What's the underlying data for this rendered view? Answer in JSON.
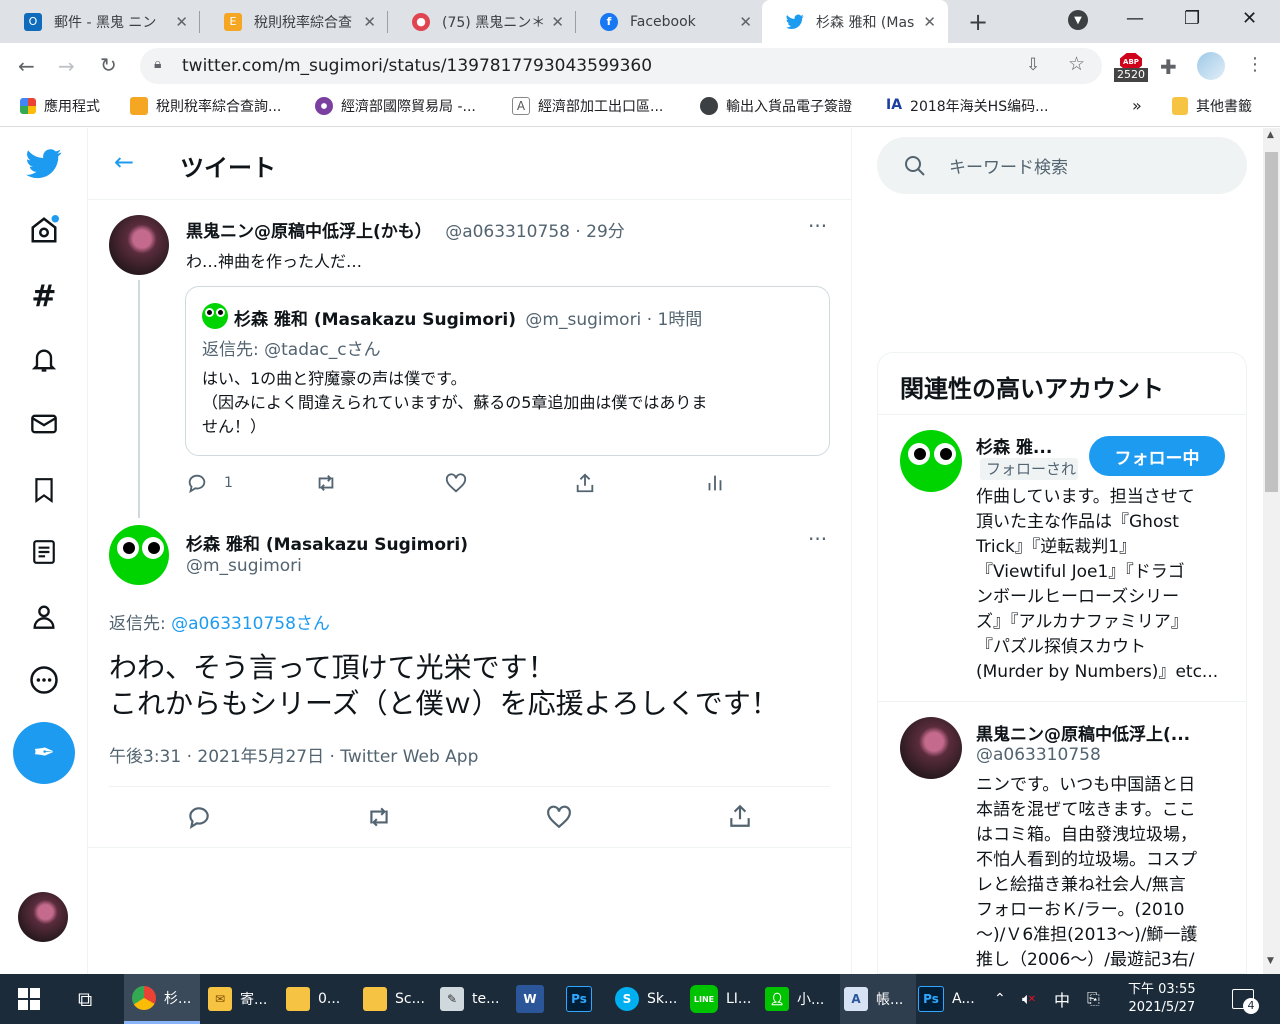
{
  "browser": {
    "tabs": [
      {
        "title": "郵件 - 黑鬼 ニン"
      },
      {
        "title": "稅則稅率綜合查"
      },
      {
        "title": "(75) 黑鬼ニン＊"
      },
      {
        "title": "Facebook"
      },
      {
        "title": "杉森 雅和 (Mas"
      }
    ],
    "url": "twitter.com/m_sugimori/status/1397817793043599360",
    "abp_count": "2520",
    "bookmarks": [
      {
        "label": "應用程式"
      },
      {
        "label": "稅則稅率綜合查詢..."
      },
      {
        "label": "經濟部國際貿易局 -..."
      },
      {
        "label": "經濟部加工出口區..."
      },
      {
        "label": "輸出入貨品電子簽證"
      },
      {
        "label": "2018年海关HS编码..."
      }
    ],
    "bookmarks_more": "»",
    "other_bookmarks": "其他書籤"
  },
  "header": {
    "title": "ツイート"
  },
  "parent_tweet": {
    "name": "黒鬼ニン@原稿中低浮上(かも）",
    "handle_time": "@a063310758 · 29分",
    "text": "わ…神曲を作った人だ…",
    "quote": {
      "name": "杉森 雅和 (Masakazu Sugimori)",
      "handle_time": "@m_sugimori · 1時間",
      "reply_prefix": "返信先: ",
      "reply_to": "@tadac_cさん",
      "line1": "はい、1の曲と狩魔豪の声は僕です。",
      "line2": "（因みによく間違えられていますが、蘇るの5章追加曲は僕ではありま",
      "line3": "せん！）"
    },
    "reply_count": "1"
  },
  "main_tweet": {
    "name": "杉森 雅和 (Masakazu Sugimori)",
    "handle": "@m_sugimori",
    "reply_prefix": "返信先: ",
    "reply_to": "@a063310758さん",
    "line1": "わわ、そう言って頂けて光栄です！",
    "line2": "これからもシリーズ（と僕ｗ）を応援よろしくです！",
    "meta": "午後3:31 · 2021年5月27日 · Twitter Web App"
  },
  "sidebar": {
    "search_placeholder": "キーワード検索",
    "related_title": "関連性の高いアカウント",
    "accounts": [
      {
        "name": "杉森 雅...",
        "follows_you": "フォローされ",
        "button": "フォロー中",
        "bio": [
          "作曲しています。担当させて",
          "頂いた主な作品は『Ghost",
          "Trick』『逆転裁判1』",
          "『Viewtiful Joe1』『ドラゴ",
          "ンボールヒーローズシリー",
          "ズ』『アルカナファミリア』",
          "『パズル探偵スカウト",
          "(Murder by Numbers)』etc..."
        ]
      },
      {
        "name": "黒鬼ニン@原稿中低浮上(...",
        "handle": "@a063310758",
        "bio": [
          "ニンです。いつも中国語と日",
          "本語を混ぜて呟きます。ここ",
          "はコミ箱。自由發洩垃圾場，",
          "不怕人看到的垃圾場。コスプ",
          "レと絵描き兼ね社会人/無言",
          "フォローおＫ/ラー。(2010",
          "〜)/Ｖ6准担(2013〜)/鰤一護",
          "推し（2006〜）/最遊記3右/"
        ]
      }
    ]
  },
  "taskbar": {
    "apps": [
      {
        "label": "杉..."
      },
      {
        "label": "寄..."
      },
      {
        "label": "0..."
      },
      {
        "label": "Sc..."
      },
      {
        "label": "te..."
      },
      {
        "label": ""
      },
      {
        "label": ""
      },
      {
        "label": "Sk..."
      },
      {
        "label": "LI..."
      },
      {
        "label": "小..."
      },
      {
        "label": "帳..."
      },
      {
        "label": "A..."
      }
    ],
    "ime": "中",
    "time": "下午 03:55",
    "date": "2021/5/27",
    "notifications": "4"
  }
}
